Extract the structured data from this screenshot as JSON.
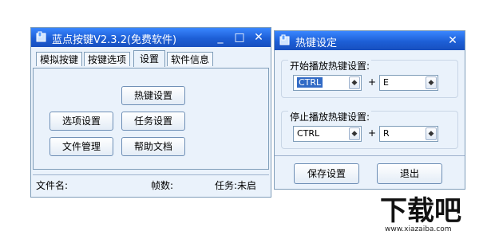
{
  "main_window": {
    "title": "蓝点按键V2.3.2(免费软件)",
    "minimize": "_",
    "maximize": "□",
    "close": "✕",
    "tabs": [
      {
        "label": "模拟按键"
      },
      {
        "label": "按键选项"
      },
      {
        "label": "设置",
        "active": true
      },
      {
        "label": "软件信息"
      }
    ],
    "buttons": {
      "hotkey_settings": "热键设置",
      "option_settings": "选项设置",
      "task_settings": "任务设置",
      "file_management": "文件管理",
      "help_docs": "帮助文档"
    },
    "status": {
      "filename_label": "文件名:",
      "frames_label": "帧数:",
      "task_label": "任务:未启"
    }
  },
  "hotkey_dialog": {
    "title": "热键设定",
    "close": "✕",
    "start_group": {
      "label": "开始播放热键设置:",
      "modifier": "CTRL",
      "plus": "+",
      "key": "E"
    },
    "stop_group": {
      "label": "停止播放热键设置:",
      "modifier": "CTRL",
      "plus": "+",
      "key": "R"
    },
    "save_button": "保存设置",
    "exit_button": "退出"
  },
  "watermark": {
    "logo_text": "下载吧",
    "url": "www.xiazaiba.com"
  },
  "colors": {
    "titlebar": "#1d5fd6",
    "window_bg": "#eaf2fb",
    "border": "#7f9db9",
    "selection": "#316ac5"
  }
}
